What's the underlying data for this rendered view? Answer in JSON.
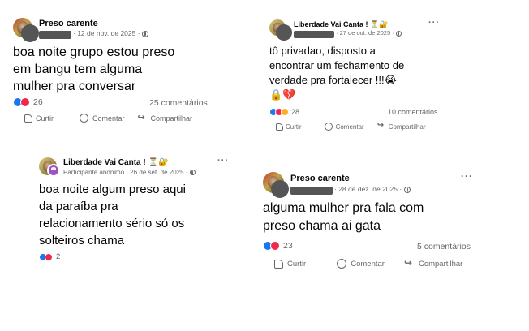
{
  "posts": [
    {
      "group": "Preso carente",
      "date": "12 de nov. de 2025",
      "text": "boa noite grupo estou preso\nem bangu tem alguma\nmulher pra conversar",
      "reactions": "26",
      "comments": "25 comentários",
      "actions": {
        "like": "Curtir",
        "comment": "Comentar",
        "share": "Compartilhar"
      }
    },
    {
      "group": "Liberdade Vai Canta !",
      "date": "27 de out. de 2025",
      "text": "tô privadao, disposto a\nencontrar um fechamento de\nverdade pra fortalecer  !!!😭\n🔒💔",
      "reactions": "28",
      "comments": "10 comentários",
      "actions": {
        "like": "Curtir",
        "comment": "Comentar",
        "share": "Compartilhar"
      }
    },
    {
      "group": "Liberdade Vai Canta !",
      "author": "Participante anônimo",
      "date": "26 de set. de 2025",
      "text": "boa noite algum preso aqui\nda paraíba pra\nrelacionamento sério só os\nsolteiros chama",
      "reactions": "2"
    },
    {
      "group": "Preso carente",
      "date": "28 de dez. de 2025",
      "text": "alguma mulher pra fala com\npreso chama ai gata",
      "reactions": "23",
      "comments": "5 comentários",
      "actions": {
        "like": "Curtir",
        "comment": "Comentar",
        "share": "Compartilhar"
      }
    }
  ],
  "icons": {
    "more": "three-dots-icon",
    "privacy": "globe-icon",
    "group_badges": [
      "hourglass-emoji",
      "lock-emoji"
    ]
  },
  "colors": {
    "like": "#1877f2",
    "love": "#f02849",
    "care": "#f7b125",
    "meta": "#65676b"
  }
}
